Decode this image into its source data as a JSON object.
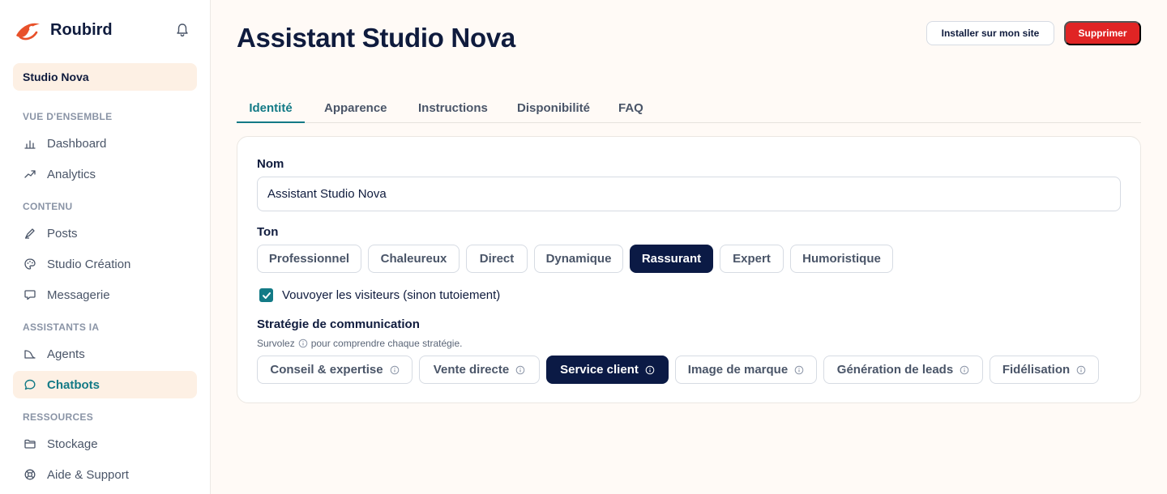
{
  "sidebar": {
    "brand_name": "Roubird",
    "workspace": "Studio Nova",
    "sections": [
      {
        "label": "VUE D'ENSEMBLE"
      },
      {
        "label": "CONTENU"
      },
      {
        "label": "ASSISTANTS IA"
      },
      {
        "label": "RESSOURCES"
      }
    ],
    "items": [
      {
        "label": "Dashboard",
        "icon": "bar-chart-icon"
      },
      {
        "label": "Analytics",
        "icon": "trend-icon"
      },
      {
        "label": "Posts",
        "icon": "pen-icon"
      },
      {
        "label": "Studio Création",
        "icon": "palette-icon"
      },
      {
        "label": "Messagerie",
        "icon": "message-icon"
      },
      {
        "label": "Agents",
        "icon": "agent-icon"
      },
      {
        "label": "Chatbots",
        "icon": "chat-icon",
        "active": true
      },
      {
        "label": "Stockage",
        "icon": "folder-icon"
      },
      {
        "label": "Aide & Support",
        "icon": "lifebuoy-icon"
      }
    ]
  },
  "header": {
    "title": "Assistant Studio Nova",
    "install_label": "Installer sur mon site",
    "delete_label": "Supprimer"
  },
  "tabs": [
    {
      "label": "Identité",
      "active": true
    },
    {
      "label": "Apparence"
    },
    {
      "label": "Instructions"
    },
    {
      "label": "Disponibilité"
    },
    {
      "label": "FAQ"
    }
  ],
  "form": {
    "name_label": "Nom",
    "name_value": "Assistant Studio Nova",
    "tone_label": "Ton",
    "tones": [
      "Professionnel",
      "Chaleureux",
      "Direct",
      "Dynamique",
      "Rassurant",
      "Expert",
      "Humoristique"
    ],
    "selected_tone": "Rassurant",
    "vouvoyer_label": "Vouvoyer les visiteurs (sinon tutoiement)",
    "vouvoyer_checked": true,
    "strategy_label": "Stratégie de communication",
    "strategy_hint_before": "Survolez",
    "strategy_hint_after": "pour comprendre chaque stratégie.",
    "strategies": [
      "Conseil & expertise",
      "Vente directe",
      "Service client",
      "Image de marque",
      "Génération de leads",
      "Fidélisation"
    ],
    "selected_strategy": "Service client"
  },
  "colors": {
    "accent": "#137a86",
    "brand": "#e8512a",
    "navy": "#0b1a45",
    "danger": "#e02424"
  }
}
